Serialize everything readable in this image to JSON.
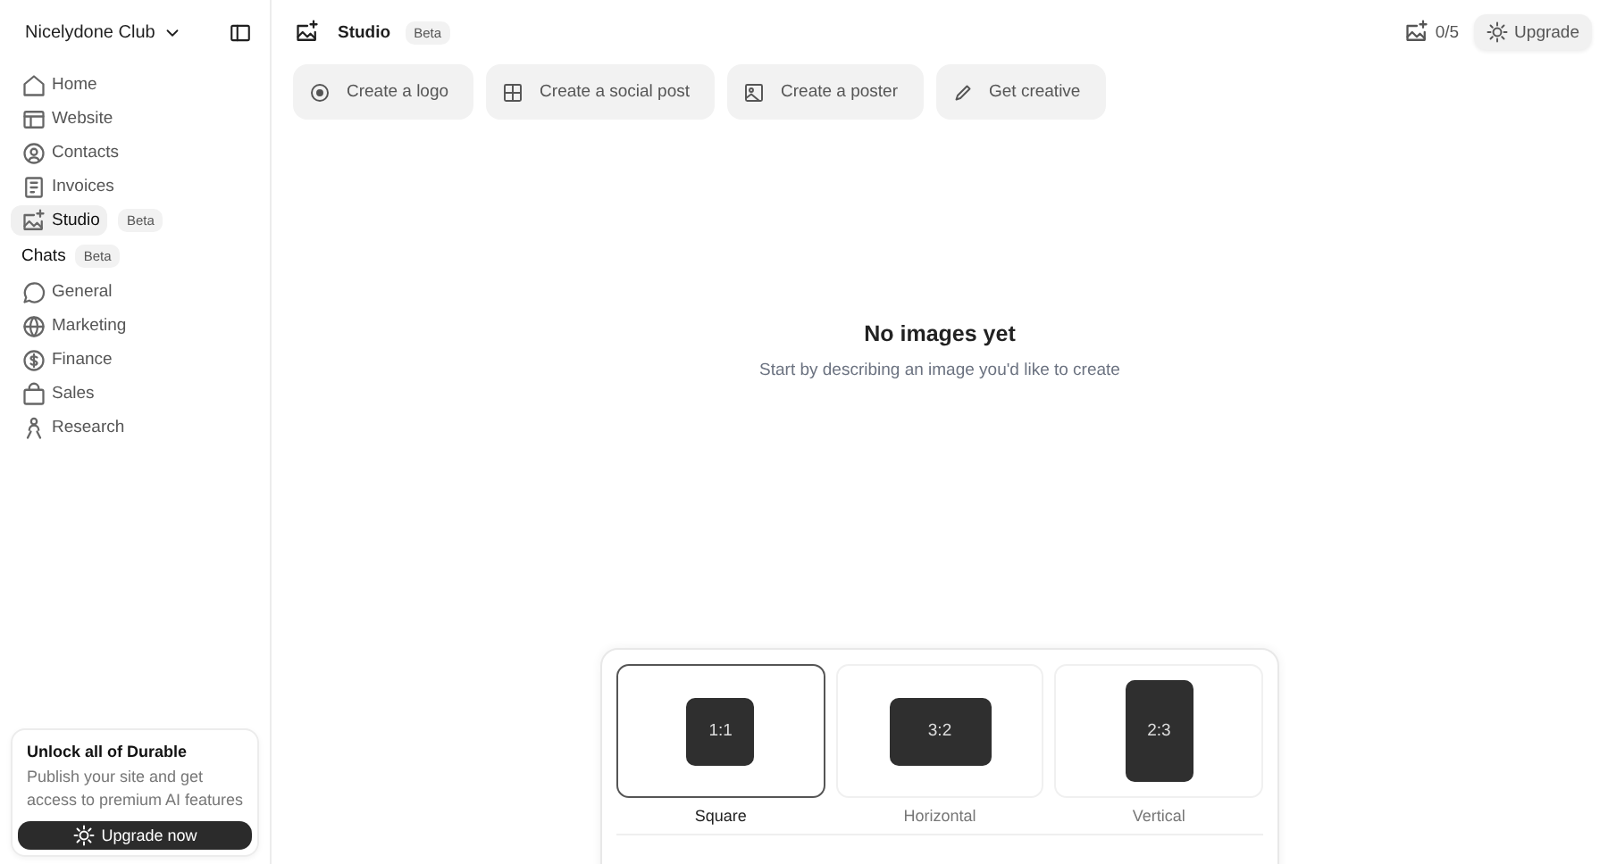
{
  "sidebar": {
    "workspace": "Nicelydone Club",
    "items": [
      {
        "label": "Home",
        "selected": false
      },
      {
        "label": "Website",
        "selected": false
      },
      {
        "label": "Contacts",
        "selected": false
      },
      {
        "label": "Invoices",
        "selected": false
      },
      {
        "label": "Studio",
        "selected": true,
        "badge": "Beta"
      }
    ],
    "chats_heading": "Chats",
    "chats_badge": "Beta",
    "chats": [
      {
        "label": "General"
      },
      {
        "label": "Marketing"
      },
      {
        "label": "Finance"
      },
      {
        "label": "Sales"
      },
      {
        "label": "Research"
      }
    ],
    "promo": {
      "title": "Unlock all of Durable",
      "text": "Publish your site and get access to premium AI features",
      "button": "Upgrade now"
    }
  },
  "header": {
    "title": "Studio",
    "badge": "Beta",
    "credits": "0/5",
    "upgrade": "Upgrade"
  },
  "suggestions": [
    "Create a logo",
    "Create a social post",
    "Create a poster",
    "Get creative"
  ],
  "empty_state": {
    "title": "No images yet",
    "text": "Start by describing an image you'd like to create"
  },
  "aspect_options": [
    {
      "kind": "square",
      "ratio": "1:1",
      "label": "Square",
      "selected": true
    },
    {
      "kind": "horizontal",
      "ratio": "3:2",
      "label": "Horizontal",
      "selected": false
    },
    {
      "kind": "vertical",
      "ratio": "2:3",
      "label": "Vertical",
      "selected": false
    }
  ]
}
